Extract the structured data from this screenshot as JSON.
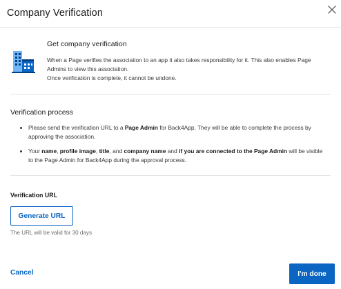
{
  "dialog": {
    "title": "Company Verification",
    "close_icon": "close-icon"
  },
  "intro": {
    "icon": "building-icon",
    "heading": "Get company verification",
    "line1": "When a Page verifies the association to an app it also takes responsibility for it. This also enables Page Admins to view this association.",
    "line2": "Once verification is complete, it cannot be undone."
  },
  "process": {
    "heading": "Verification process",
    "bullet1": {
      "t1": "Please send the verification URL to a ",
      "b1": "Page Admin",
      "t2": " for Back4App. They will be able to complete the process by approving the association."
    },
    "bullet2": {
      "t1": "Your ",
      "b1": "name",
      "t2": ", ",
      "b2": "profile image",
      "t3": ", ",
      "b3": "title",
      "t4": ", and ",
      "b4": "company name",
      "t5": " and ",
      "b5": "if you are connected to the Page Admin",
      "t6": " will be visible to the Page Admin for Back4App during the approval process."
    }
  },
  "url": {
    "label": "Verification URL",
    "button": "Generate URL",
    "hint": "The URL will be valid for 30 days"
  },
  "footer": {
    "cancel": "Cancel",
    "done": "I'm done"
  },
  "colors": {
    "accent": "#0a66c2",
    "icon_dark": "#004182",
    "icon_light": "#70b5f9",
    "divider": "#e3e3e3"
  }
}
